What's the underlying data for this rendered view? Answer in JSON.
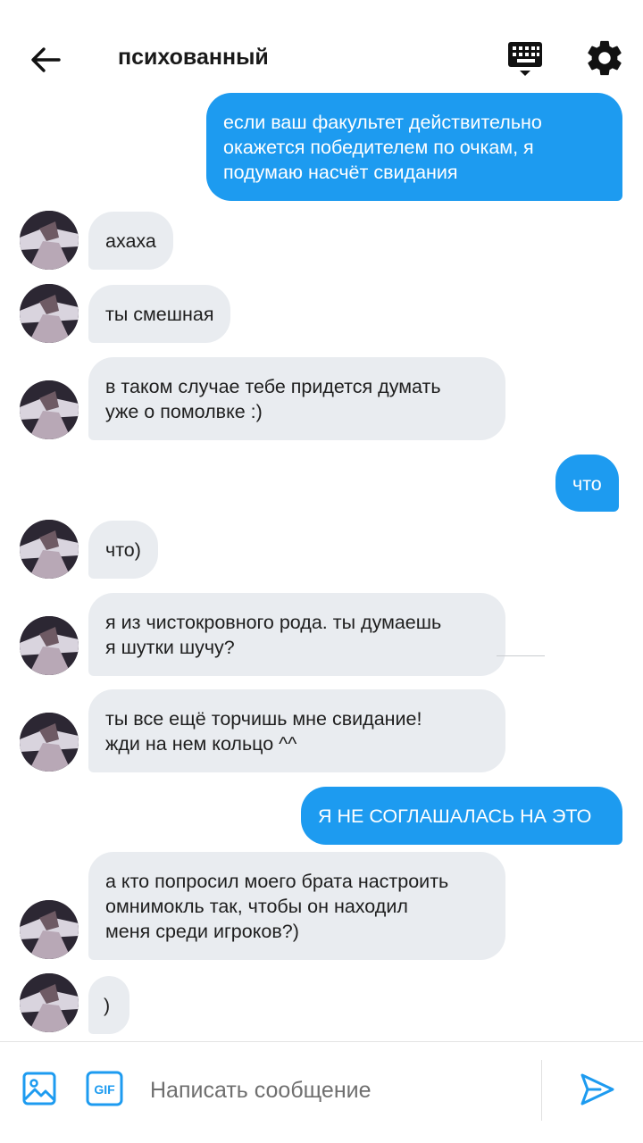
{
  "header": {
    "title": "психованный",
    "back_icon": "arrow-left-icon",
    "keyboard_icon": "keyboard-icon",
    "settings_icon": "gear-icon"
  },
  "messages": [
    {
      "direction": "out",
      "text": "если ваш факультет действительно\nокажется победителем по очкам, я\nподумаю насчёт свидания"
    },
    {
      "direction": "in",
      "text": "ахаха"
    },
    {
      "direction": "in",
      "text": "ты смешная"
    },
    {
      "direction": "in",
      "text": "в таком случае тебе придется думать\nуже о помолвке :)"
    },
    {
      "direction": "out",
      "text": "что"
    },
    {
      "direction": "in",
      "text": "что)"
    },
    {
      "direction": "in",
      "text": "я из чистокровного рода. ты думаешь\nя шутки шучу?"
    },
    {
      "direction": "in",
      "text": "ты все ещё торчишь мне свидание!\nжди на нем кольцо ^^"
    },
    {
      "direction": "out",
      "text": "Я НЕ СОГЛАШАЛАСЬ НА ЭТО"
    },
    {
      "direction": "in",
      "text": "а кто попросил моего брата настроить\nомнимокль так, чтобы он находил\nменя среди игроков?)"
    },
    {
      "direction": "in",
      "text": ")"
    }
  ],
  "composer": {
    "placeholder": "Написать сообщение",
    "value": "",
    "image_icon": "image-icon",
    "gif_label": "GIF",
    "send_icon": "send-icon"
  },
  "colors": {
    "accent": "#1d9bf0",
    "incoming_bubble": "#e9ecf0",
    "background": "#ffffff"
  }
}
